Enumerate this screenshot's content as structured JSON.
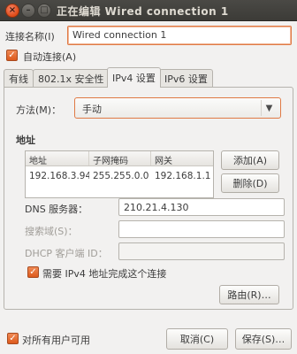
{
  "window": {
    "title": "正在编辑 Wired connection 1",
    "close_glyph": "×",
    "min_glyph": "–",
    "max_glyph": "□"
  },
  "connection_name": {
    "label": "连接名称(I)",
    "value": "Wired connection 1"
  },
  "auto_connect": {
    "label": "自动连接(A)",
    "checked": true
  },
  "tabs": [
    {
      "label": "有线",
      "active": false
    },
    {
      "label": "802.1x 安全性",
      "active": false
    },
    {
      "label": "IPv4 设置",
      "active": true
    },
    {
      "label": "IPv6 设置",
      "active": false
    }
  ],
  "method": {
    "label": "方法(M)：",
    "value": "手动",
    "arrow_icon": "triangle-down-icon"
  },
  "address": {
    "title": "地址",
    "headers": [
      "地址",
      "子网掩码",
      "网关"
    ],
    "rows": [
      [
        "192.168.3.94",
        "255.255.0.0",
        "192.168.1.1"
      ]
    ],
    "add_label": "添加(A)",
    "delete_label": "删除(D)"
  },
  "dns": {
    "label": "DNS 服务器：",
    "value": "210.21.4.130"
  },
  "search_domains": {
    "label": "搜索域(S)：",
    "value": ""
  },
  "dhcp_client_id": {
    "label": "DHCP 客户端 ID：",
    "value": ""
  },
  "require_ipv4": {
    "label": "需要 IPv4 地址完成这个连接",
    "checked": true
  },
  "routes_label": "路由(R)…",
  "all_users": {
    "label": "对所有用户可用",
    "checked": true
  },
  "cancel_label": "取消(C)",
  "save_label": "保存(S)…",
  "colors": {
    "accent": "#dd5a1c",
    "titlebar": "#3c3b37",
    "background": "#f2f1f0"
  }
}
